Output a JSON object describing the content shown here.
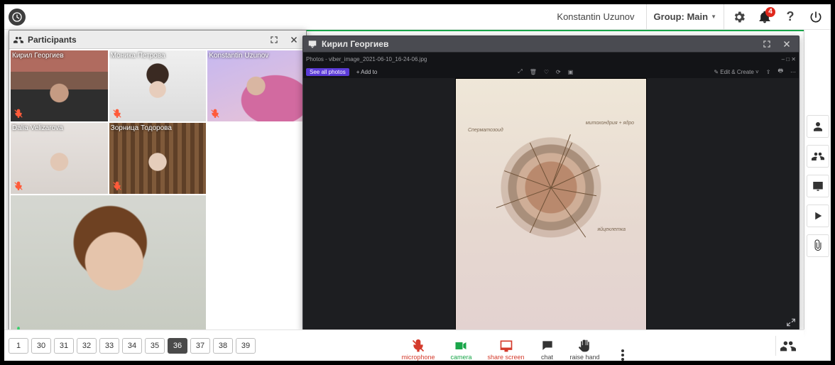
{
  "header": {
    "user_name": "Konstantin Uzunov",
    "group_label": "Group: Main",
    "notifications_count": "4"
  },
  "participants_panel": {
    "title": "Participants",
    "tiles": [
      {
        "name": "Кирил Георгиев",
        "muted": "red",
        "active": true
      },
      {
        "name": "Моника Петрова",
        "muted": "red",
        "active": false
      },
      {
        "name": "Konstantin Uzunov",
        "muted": "red",
        "active": false
      },
      {
        "name": "Dalia Velizarova",
        "muted": "red",
        "active": false
      },
      {
        "name": "Зорница Тодорова",
        "muted": "red",
        "active": false
      }
    ],
    "host_muted": "green"
  },
  "share_panel": {
    "title": "Кирил Георгиев",
    "photos_filename": "Photos - viber_image_2021-06-10_16-24-06.jpg",
    "see_all_label": "See all photos",
    "add_to_label": "+  Add to",
    "edit_label": "Edit & Create",
    "drawing_labels": {
      "l1": "Cперматозоид",
      "l2": "митохондрия + ядро",
      "l3": "яйцеклетка"
    }
  },
  "pages": [
    "1",
    "30",
    "31",
    "32",
    "33",
    "34",
    "35",
    "36",
    "37",
    "38",
    "39"
  ],
  "active_page": "36",
  "tools": {
    "microphone": "microphone",
    "camera": "camera",
    "share_screen": "share screen",
    "chat": "chat",
    "raise_hand": "raise hand"
  }
}
